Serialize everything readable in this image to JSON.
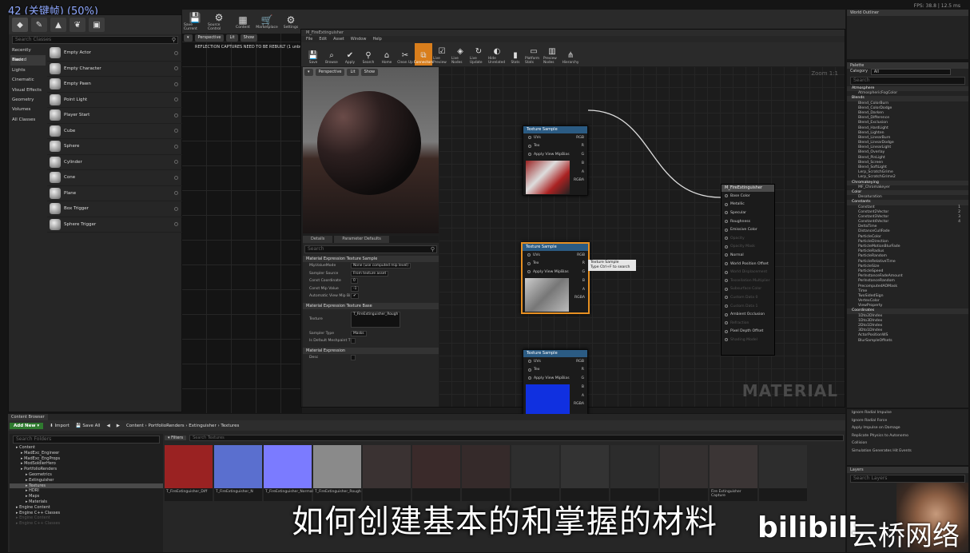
{
  "frame_label": "42 (关键帧) (50%)",
  "fps_text": "FPS: 38.8 | 12.5 ms",
  "modes": {
    "search_placeholder": "Search Classes",
    "categories": [
      "Recently Placed",
      "Basic",
      "Lights",
      "Cinematic",
      "Visual Effects",
      "Geometry",
      "Volumes",
      "All Classes"
    ],
    "items": [
      "Empty Actor",
      "Empty Character",
      "Empty Pawn",
      "Point Light",
      "Player Start",
      "Cube",
      "Sphere",
      "Cylinder",
      "Cone",
      "Plane",
      "Box Trigger",
      "Sphere Trigger"
    ]
  },
  "main_toolbar": [
    {
      "icon": "💾",
      "label": "Save Current"
    },
    {
      "icon": "⚙",
      "label": "Source Control"
    },
    {
      "icon": "▦",
      "label": "Content"
    },
    {
      "icon": "🛒",
      "label": "Marketplace"
    },
    {
      "icon": "⚙",
      "label": "Settings"
    }
  ],
  "viewport": {
    "perspective": "Perspective",
    "lit": "Lit",
    "show": "Show",
    "warning": "REFLECTION CAPTURES NEED TO BE REBUILT (1 unbu"
  },
  "material_editor": {
    "tab": "M_FireExtinguisher",
    "menu": [
      "File",
      "Edit",
      "Asset",
      "Window",
      "Help"
    ],
    "toolbar": [
      "Save",
      "Browse",
      "Apply",
      "Search",
      "Home",
      "Clean Up",
      "Connectors",
      "Live Preview",
      "Live Nodes",
      "Live Update",
      "Hide Unrelated",
      "Stats",
      "Platform Stats",
      "Preview Nodes",
      "Hierarchy"
    ],
    "preview": {
      "perspective": "Perspective",
      "lit": "Lit",
      "show": "Show"
    },
    "details": {
      "tabs": [
        "Details",
        "Parameter Defaults"
      ],
      "search_placeholder": "Search",
      "sections": [
        {
          "title": "Material Expression Texture Sample",
          "rows": [
            [
              "MipValueMode",
              "None (use computed mip level)"
            ],
            [
              "Sampler Source",
              "From texture asset"
            ],
            [
              "Const Coordinate",
              "0"
            ],
            [
              "Const Mip Value",
              "-1"
            ],
            [
              "Automatic View Mip Bi",
              "✔"
            ]
          ]
        },
        {
          "title": "Material Expression Texture Base",
          "rows": [
            [
              "Texture",
              "T_FireExtinguisher_Rough"
            ],
            [
              "Sampler Type",
              "Masks"
            ],
            [
              "Is Default Meshpaint T",
              ""
            ]
          ]
        },
        {
          "title": "Material Expression",
          "rows": [
            [
              "Desc",
              ""
            ]
          ]
        }
      ]
    },
    "zoom": "Zoom 1:1",
    "watermark": "MATERIAL",
    "nodes": [
      {
        "title": "Texture Sample",
        "pins": [
          "UVs",
          "Tex",
          "Apply View MipBias"
        ],
        "outs": [
          "RGB",
          "R",
          "G",
          "B",
          "A",
          "RGBA"
        ]
      },
      {
        "title": "Texture Sample",
        "pins": [
          "UVs",
          "Tex",
          "Apply View MipBias"
        ],
        "outs": [
          "RGB",
          "R",
          "G",
          "B",
          "A",
          "RGBA"
        ]
      },
      {
        "title": "Texture Sample",
        "pins": [
          "UVs",
          "Tex",
          "Apply View MipBias"
        ],
        "outs": [
          "RGB",
          "R",
          "G",
          "B",
          "A",
          "RGBA"
        ]
      }
    ],
    "tooltip": [
      "Texture Sample",
      "Type Ctrl+F to search"
    ],
    "material_node": {
      "title": "M_FireExtinguisher",
      "pins": [
        {
          "label": "Base Color",
          "dim": false
        },
        {
          "label": "Metallic",
          "dim": false
        },
        {
          "label": "Specular",
          "dim": false
        },
        {
          "label": "Roughness",
          "dim": false
        },
        {
          "label": "Emissive Color",
          "dim": false
        },
        {
          "label": "Opacity",
          "dim": true
        },
        {
          "label": "Opacity Mask",
          "dim": true
        },
        {
          "label": "Normal",
          "dim": false
        },
        {
          "label": "World Position Offset",
          "dim": false
        },
        {
          "label": "World Displacement",
          "dim": true
        },
        {
          "label": "Tessellation Multiplier",
          "dim": true
        },
        {
          "label": "Subsurface Color",
          "dim": true
        },
        {
          "label": "Custom Data 0",
          "dim": true
        },
        {
          "label": "Custom Data 1",
          "dim": true
        },
        {
          "label": "Ambient Occlusion",
          "dim": false
        },
        {
          "label": "Refraction",
          "dim": true
        },
        {
          "label": "Pixel Depth Offset",
          "dim": false
        },
        {
          "label": "Shading Model",
          "dim": true
        }
      ]
    }
  },
  "world_outliner": {
    "title": "World Outliner"
  },
  "palette": {
    "title": "Palette",
    "category_label": "Category",
    "category_value": "All",
    "search_placeholder": "Search",
    "entries": [
      {
        "t": "cat",
        "v": "Atmosphere"
      },
      {
        "t": "i",
        "v": "AtmosphericFogColor"
      },
      {
        "t": "cat",
        "v": "Blends"
      },
      {
        "t": "i",
        "v": "Blend_ColorBurn"
      },
      {
        "t": "i",
        "v": "Blend_ColorDodge"
      },
      {
        "t": "i",
        "v": "Blend_Darken"
      },
      {
        "t": "i",
        "v": "Blend_Difference"
      },
      {
        "t": "i",
        "v": "Blend_Exclusion"
      },
      {
        "t": "i",
        "v": "Blend_HardLight"
      },
      {
        "t": "i",
        "v": "Blend_Lighten"
      },
      {
        "t": "i",
        "v": "Blend_LinearBurn"
      },
      {
        "t": "i",
        "v": "Blend_LinearDodge"
      },
      {
        "t": "i",
        "v": "Blend_LinearLight"
      },
      {
        "t": "i",
        "v": "Blend_Overlay"
      },
      {
        "t": "i",
        "v": "Blend_PinLight"
      },
      {
        "t": "i",
        "v": "Blend_Screen"
      },
      {
        "t": "i",
        "v": "Blend_SoftLight"
      },
      {
        "t": "i",
        "v": "Lerp_ScratchGrime"
      },
      {
        "t": "i",
        "v": "Lerp_ScratchGrime2"
      },
      {
        "t": "cat",
        "v": "Chromakeying"
      },
      {
        "t": "i",
        "v": "MF_Chromakeyer"
      },
      {
        "t": "cat",
        "v": "Color"
      },
      {
        "t": "i",
        "v": "Desaturation"
      },
      {
        "t": "cat",
        "v": "Constants"
      },
      {
        "t": "i",
        "v": "Constant",
        "n": "1"
      },
      {
        "t": "i",
        "v": "Constant2Vector",
        "n": "2"
      },
      {
        "t": "i",
        "v": "Constant3Vector",
        "n": "3"
      },
      {
        "t": "i",
        "v": "Constant4Vector",
        "n": "4"
      },
      {
        "t": "i",
        "v": "DeltaTime"
      },
      {
        "t": "i",
        "v": "DistanceCullFade"
      },
      {
        "t": "i",
        "v": "ParticleColor"
      },
      {
        "t": "i",
        "v": "ParticleDirection"
      },
      {
        "t": "i",
        "v": "ParticleMotionBlurFade"
      },
      {
        "t": "i",
        "v": "ParticleRadius"
      },
      {
        "t": "i",
        "v": "ParticleRandom"
      },
      {
        "t": "i",
        "v": "ParticleRelativeTime"
      },
      {
        "t": "i",
        "v": "ParticleSize"
      },
      {
        "t": "i",
        "v": "ParticleSpeed"
      },
      {
        "t": "i",
        "v": "PerInstanceFadeAmount"
      },
      {
        "t": "i",
        "v": "PerInstanceRandom"
      },
      {
        "t": "i",
        "v": "PrecomputedAOMask"
      },
      {
        "t": "i",
        "v": "Time"
      },
      {
        "t": "i",
        "v": "TwoSidedSign"
      },
      {
        "t": "i",
        "v": "VertexColor"
      },
      {
        "t": "i",
        "v": "ViewProperty"
      },
      {
        "t": "cat",
        "v": "Coordinates"
      },
      {
        "t": "i",
        "v": "1Dto2DIndex"
      },
      {
        "t": "i",
        "v": "1Dto3DIndex"
      },
      {
        "t": "i",
        "v": "2Dto1DIndex"
      },
      {
        "t": "i",
        "v": "3Dto1DIndex"
      },
      {
        "t": "i",
        "v": "ActorPositionWS"
      },
      {
        "t": "i",
        "v": "BlurSampleOffsets"
      }
    ]
  },
  "lower_right": [
    "Ignore Radial Impulse",
    "Ignore Radial Force",
    "Apply Impulse on Damage",
    "Replicate Physics to Autonomo",
    "Collision",
    "Simulation Generates Hit Events"
  ],
  "layers": {
    "title": "Layers",
    "search_placeholder": "Search Layers"
  },
  "content_browser": {
    "tab": "Content Browser",
    "add_new": "Add New",
    "import": "Import",
    "save_all": "Save All",
    "breadcrumb": [
      "Content",
      "PortfolioRenders",
      "Extinguisher",
      "Textures"
    ],
    "folder_search": "Search Folders",
    "filters": "Filters",
    "asset_search": "Search Textures",
    "tree": [
      {
        "v": "Content",
        "lvl": 1
      },
      {
        "v": "MadExc_Engineer",
        "lvl": 2
      },
      {
        "v": "MadExc_EngProps",
        "lvl": 2
      },
      {
        "v": "ModSoldierHero",
        "lvl": 2
      },
      {
        "v": "PortfolioRenders",
        "lvl": 2
      },
      {
        "v": "Geometrics",
        "lvl": 3
      },
      {
        "v": "Extinguisher",
        "lvl": 3
      },
      {
        "v": "Textures",
        "lvl": 3,
        "sel": true
      },
      {
        "v": "HDRI",
        "lvl": 3
      },
      {
        "v": "Maps",
        "lvl": 3
      },
      {
        "v": "Materials",
        "lvl": 3
      },
      {
        "v": "Engine Content",
        "lvl": 1
      },
      {
        "v": "Engine C++ Classes",
        "lvl": 1
      },
      {
        "v": "Engine Content",
        "lvl": 1,
        "dim": true
      },
      {
        "v": "Engine C++ Classes",
        "lvl": 1,
        "dim": true
      }
    ],
    "assets": [
      {
        "label": "T_FireExtinguisher_Diff",
        "color": "#9a2222"
      },
      {
        "label": "T_FireExtinguisher_N",
        "color": "#5a6fcf"
      },
      {
        "label": "T_FireExtinguisher_Normals",
        "color": "#7b7bff"
      },
      {
        "label": "T_FireExtinguisher_Rough",
        "color": "#8a8a8a"
      },
      {
        "label": "",
        "color": "#3a3232"
      },
      {
        "label": "",
        "color": "#3a2a2a"
      },
      {
        "label": "",
        "color": "#352a2a"
      },
      {
        "label": "",
        "color": "#2e2e2e"
      },
      {
        "label": "",
        "color": "#333"
      },
      {
        "label": "",
        "color": "#2c2c2c"
      },
      {
        "label": "",
        "color": "#343030"
      },
      {
        "label": "Fire Extinguisher Capture",
        "color": "#3b3535"
      },
      {
        "label": "",
        "color": "#2d2d2d"
      }
    ]
  },
  "subtitle": "如何创建基本的和掌握的材料",
  "logo": "bilibili",
  "brand": "云桥网络"
}
